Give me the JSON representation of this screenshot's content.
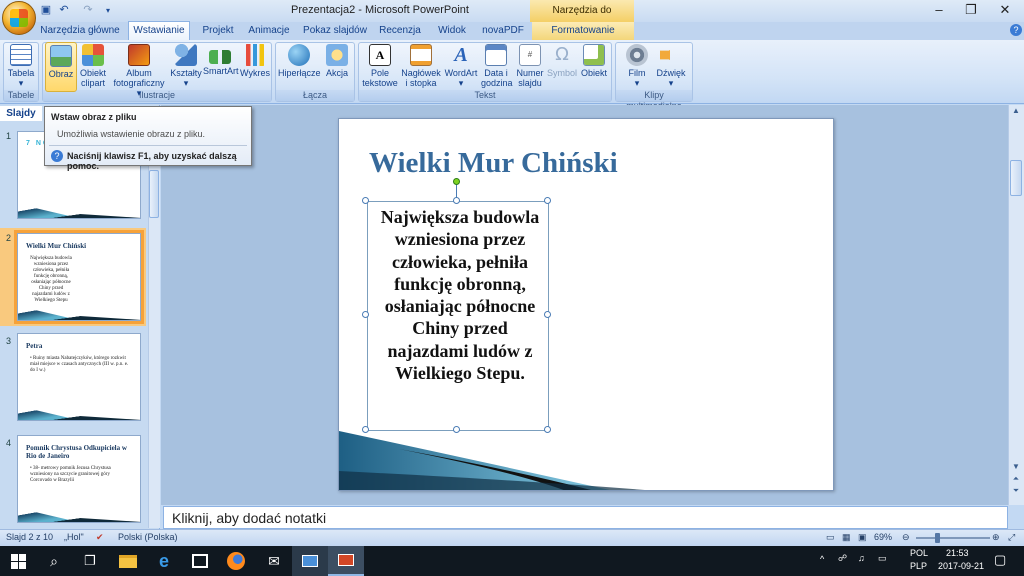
{
  "window": {
    "title": "Prezentacja2 - Microsoft PowerPoint",
    "context_label": "Narzędzia do rysowania",
    "quick_access": [
      "save-icon",
      "undo-icon",
      "redo-icon",
      "customize-icon"
    ],
    "controls": [
      "–",
      "❐",
      "✕"
    ]
  },
  "tabs": [
    {
      "label": "Narzędzia główne"
    },
    {
      "label": "Wstawianie",
      "active": true
    },
    {
      "label": "Projekt"
    },
    {
      "label": "Animacje"
    },
    {
      "label": "Pokaz slajdów"
    },
    {
      "label": "Recenzja"
    },
    {
      "label": "Widok"
    },
    {
      "label": "novaPDF"
    },
    {
      "label": "Formatowanie"
    }
  ],
  "ribbon": {
    "groups": [
      {
        "label": "Tabele"
      },
      {
        "label": "Ilustracje"
      },
      {
        "label": "Łącza"
      },
      {
        "label": "Tekst"
      },
      {
        "label": "Klipy multimedialne"
      }
    ],
    "buttons": [
      {
        "label": "Tabela",
        "sub": "▾",
        "icon": "table-icon"
      },
      {
        "label": "Obraz",
        "sub": "",
        "icon": "picture-icon",
        "highlighted": true
      },
      {
        "label": "Obiekt",
        "sub": "clipart",
        "icon": "clipart-icon"
      },
      {
        "label": "Album",
        "sub": "fotograficzny ▾",
        "icon": "photo-album-icon"
      },
      {
        "label": "Kształty",
        "sub": "▾",
        "icon": "shapes-icon"
      },
      {
        "label": "SmartArt",
        "sub": "",
        "icon": "smartart-icon"
      },
      {
        "label": "Wykres",
        "sub": "",
        "icon": "chart-icon"
      },
      {
        "label": "Hiperłącze",
        "sub": "",
        "icon": "hyperlink-icon"
      },
      {
        "label": "Akcja",
        "sub": "",
        "icon": "action-icon"
      },
      {
        "label": "Pole",
        "sub": "tekstowe",
        "icon": "textbox-icon"
      },
      {
        "label": "Nagłówek",
        "sub": "i stopka",
        "icon": "header-footer-icon"
      },
      {
        "label": "WordArt",
        "sub": "▾",
        "icon": "wordart-icon"
      },
      {
        "label": "Data i",
        "sub": "godzina",
        "icon": "date-time-icon"
      },
      {
        "label": "Numer",
        "sub": "slajdu",
        "icon": "slide-number-icon"
      },
      {
        "label": "Symbol",
        "sub": "",
        "icon": "symbol-icon",
        "disabled": true
      },
      {
        "label": "Obiekt",
        "sub": "",
        "icon": "object-icon"
      },
      {
        "label": "Film",
        "sub": "▾",
        "icon": "film-icon"
      },
      {
        "label": "Dźwięk",
        "sub": "▾",
        "icon": "sound-icon"
      }
    ]
  },
  "tooltip": {
    "title": "Wstaw obraz z pliku",
    "description": "Umożliwia wstawienie obrazu z pliku.",
    "help": "Naciśnij klawisz F1, aby uzyskać dalszą pomoc."
  },
  "slides_pane": {
    "tab_label": "Slajdy",
    "slides": [
      {
        "number": "1",
        "title": "7 NO",
        "body": ""
      },
      {
        "number": "2",
        "title": "Wielki Mur Chiński",
        "body": "Największa budowla wzniesiona przez człowieka, pełniła funkcję obronną, osłaniając północne Chiny przed najazdami ludów z Wielkiego Stepu",
        "selected": true
      },
      {
        "number": "3",
        "title": "Petra",
        "body": "• Ruiny miasta Nabatejczyków, którego rozkwit miał miejsce w czasach antycznych (III w. p.n. e. do I w.)"
      },
      {
        "number": "4",
        "title": "Pomnik Chrystusa Odkupiciela w Rio de Janeiro",
        "body": "• 38- metrowy pomnik Jezusa Chrystusa wzniesiony na szczycie granitowej góry Corcovado w Brazylii"
      }
    ]
  },
  "slide": {
    "title": "Wielki Mur Chiński",
    "body": "Największa budowla wzniesiona przez człowieka, pełniła funkcję obronną, osłaniając północne Chiny przed najazdami ludów z Wielkiego Stepu."
  },
  "notes": {
    "placeholder": "Kliknij, aby dodać notatki"
  },
  "status": {
    "slide_info": "Slajd 2 z 10",
    "theme": "„Hol\"",
    "language": "Polski (Polska)",
    "zoom": "69%"
  },
  "taskbar": {
    "lang1": "POL",
    "lang2": "PLP",
    "time": "21:53",
    "date": "2017-09-21",
    "apps": [
      "windows-start-icon",
      "search-icon",
      "task-view-icon",
      "file-explorer-icon",
      "edge-icon",
      "store-icon",
      "firefox-icon",
      "mail-icon",
      "app-icon",
      "powerpoint-icon"
    ]
  }
}
